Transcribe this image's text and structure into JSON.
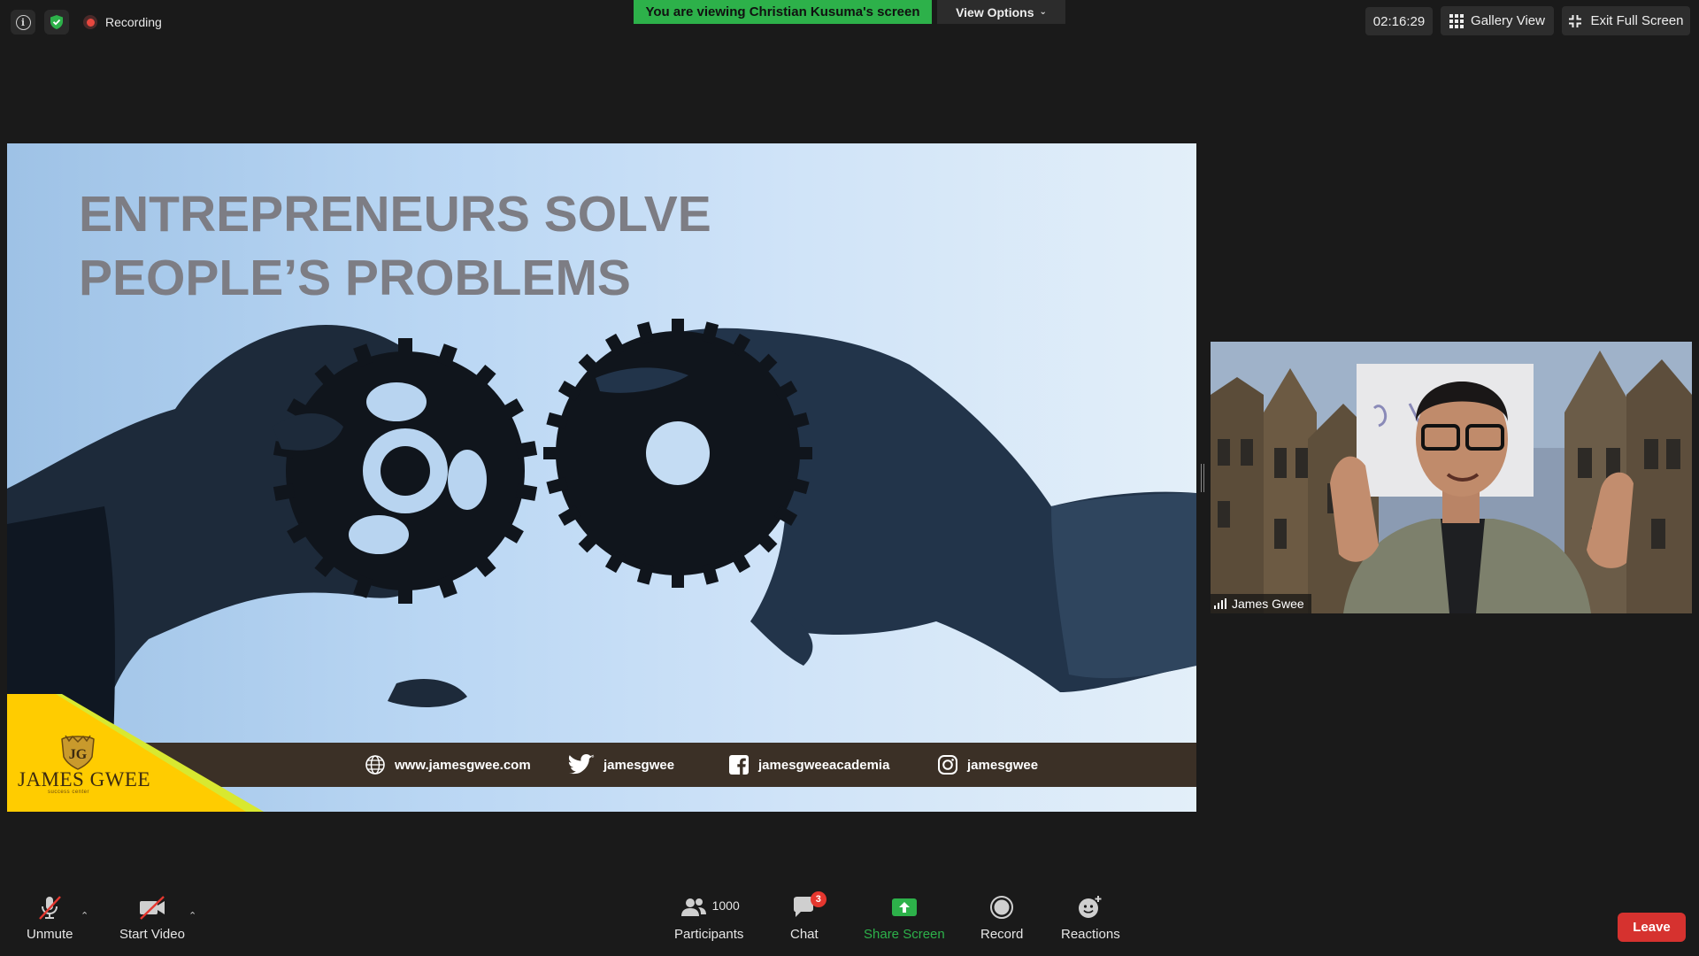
{
  "top_bar": {
    "recording_label": "Recording",
    "viewing_banner": "You are viewing Christian Kusuma's screen",
    "view_options_label": "View Options",
    "timer": "02:16:29",
    "gallery_view_label": "Gallery View",
    "exit_full_screen_label": "Exit Full Screen"
  },
  "slide": {
    "title_line1": "ENTREPRENEURS SOLVE",
    "title_line2": "PEOPLE’S PROBLEMS",
    "footer": {
      "website": "www.jamesgwee.com",
      "twitter": "jamesgwee",
      "facebook": "jamesgweeacademia",
      "instagram": "jamesgwee"
    },
    "logo_text": "JAMES GWEE",
    "logo_subtext": "success center"
  },
  "speaker": {
    "name": "James Gwee"
  },
  "toolbar": {
    "unmute_label": "Unmute",
    "start_video_label": "Start Video",
    "participants_label": "Participants",
    "participants_count": "1000",
    "chat_label": "Chat",
    "chat_badge": "3",
    "share_screen_label": "Share Screen",
    "record_label": "Record",
    "reactions_label": "Reactions",
    "leave_label": "Leave"
  },
  "colors": {
    "banner_green": "#2db14a",
    "share_green": "#2db14a",
    "leave_red": "#d6322f",
    "badge_red": "#e5372f"
  }
}
